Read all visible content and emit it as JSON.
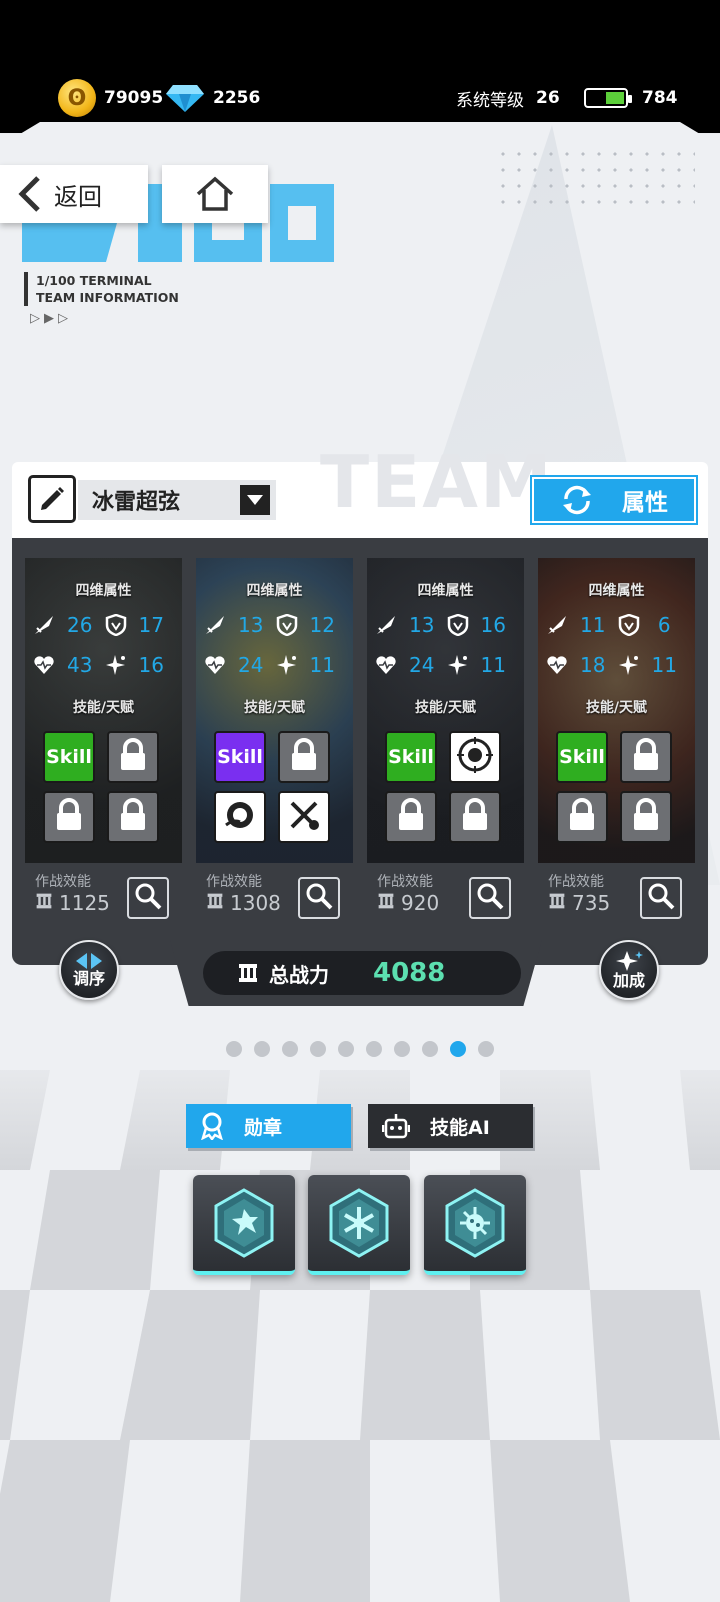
{
  "status_bar": {
    "coins": "79095",
    "gems": "2256",
    "level_label": "系统等级",
    "level": "26",
    "energy": "784"
  },
  "nav": {
    "back_label": "返回"
  },
  "header": {
    "logo_text": "1/100",
    "terminal_line1": "1/100  TERMINAL",
    "terminal_line2": "TEAM INFORMATION",
    "arrows": "▷▶▷"
  },
  "team": {
    "watermark": "TEAM",
    "name": "冰雷超弦",
    "attr_button_label": "属性"
  },
  "cards": [
    {
      "attrs_label": "四维属性",
      "atk": "26",
      "def": "17",
      "hp": "43",
      "spd": "16",
      "skill_label": "技能/天赋",
      "eff_label": "作战效能",
      "eff": "1125",
      "skill_color": "green"
    },
    {
      "attrs_label": "四维属性",
      "atk": "13",
      "def": "12",
      "hp": "24",
      "spd": "11",
      "skill_label": "技能/天赋",
      "eff_label": "作战效能",
      "eff": "1308",
      "skill_color": "purple"
    },
    {
      "attrs_label": "四维属性",
      "atk": "13",
      "def": "16",
      "hp": "24",
      "spd": "11",
      "skill_label": "技能/天赋",
      "eff_label": "作战效能",
      "eff": "920",
      "skill_color": "green"
    },
    {
      "attrs_label": "四维属性",
      "atk": "11",
      "def": "6",
      "hp": "18",
      "spd": "11",
      "skill_label": "技能/天赋",
      "eff_label": "作战效能",
      "eff": "735",
      "skill_color": "green"
    }
  ],
  "skill_text": "Skill",
  "footer": {
    "order_label": "调序",
    "bonus_label": "加成",
    "total_power_label": "总战力",
    "total_power": "4088",
    "page_count": 10,
    "current_page": 9
  },
  "tabs": {
    "medal_label": "勋章",
    "ai_label": "技能AI"
  },
  "colors": {
    "accent": "#21a7ec",
    "stat": "#22a8e6",
    "power": "#5cdfb0",
    "skill_green": "#2fae20",
    "skill_purple": "#7a2ff0"
  }
}
